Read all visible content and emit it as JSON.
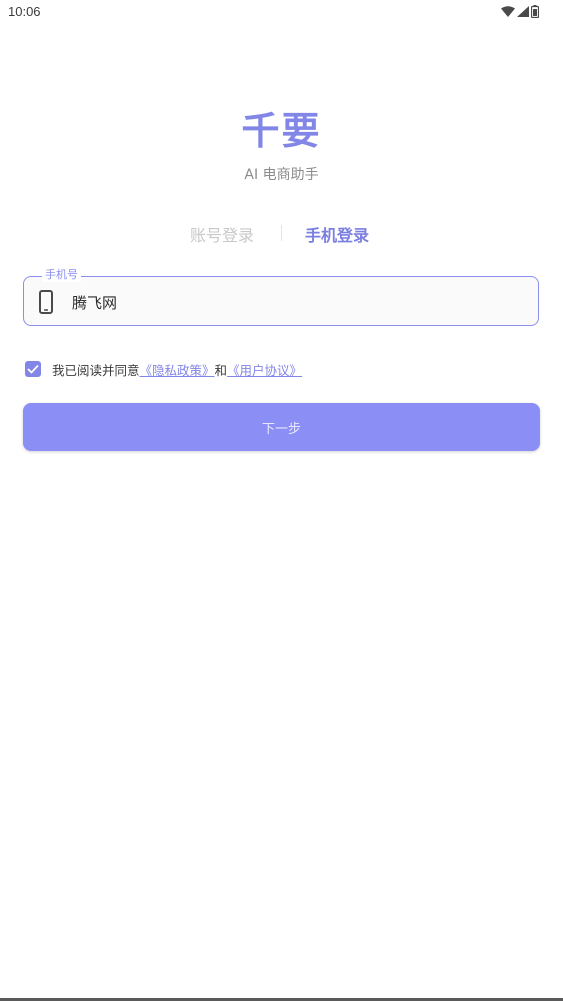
{
  "status_bar": {
    "time": "10:06",
    "icons": [
      "wifi-icon",
      "cellular-signal-icon",
      "battery-icon"
    ]
  },
  "brand": {
    "title": "千要",
    "subtitle": "AI 电商助手"
  },
  "tabs": [
    {
      "label": "账号登录",
      "active": false
    },
    {
      "label": "手机登录",
      "active": true
    }
  ],
  "phone_field": {
    "label": "手机号",
    "value": "腾飞网",
    "icon": "smartphone-icon"
  },
  "agreement": {
    "checked": true,
    "prefix": "我已阅读并同意",
    "privacy_link": "《隐私政策》",
    "and": "和",
    "terms_link": "《用户协议》"
  },
  "next_button": {
    "label": "下一步"
  },
  "colors": {
    "accent": "#8286e6",
    "button": "#8a8ef5",
    "inactive_tab": "#c8c8c8"
  }
}
